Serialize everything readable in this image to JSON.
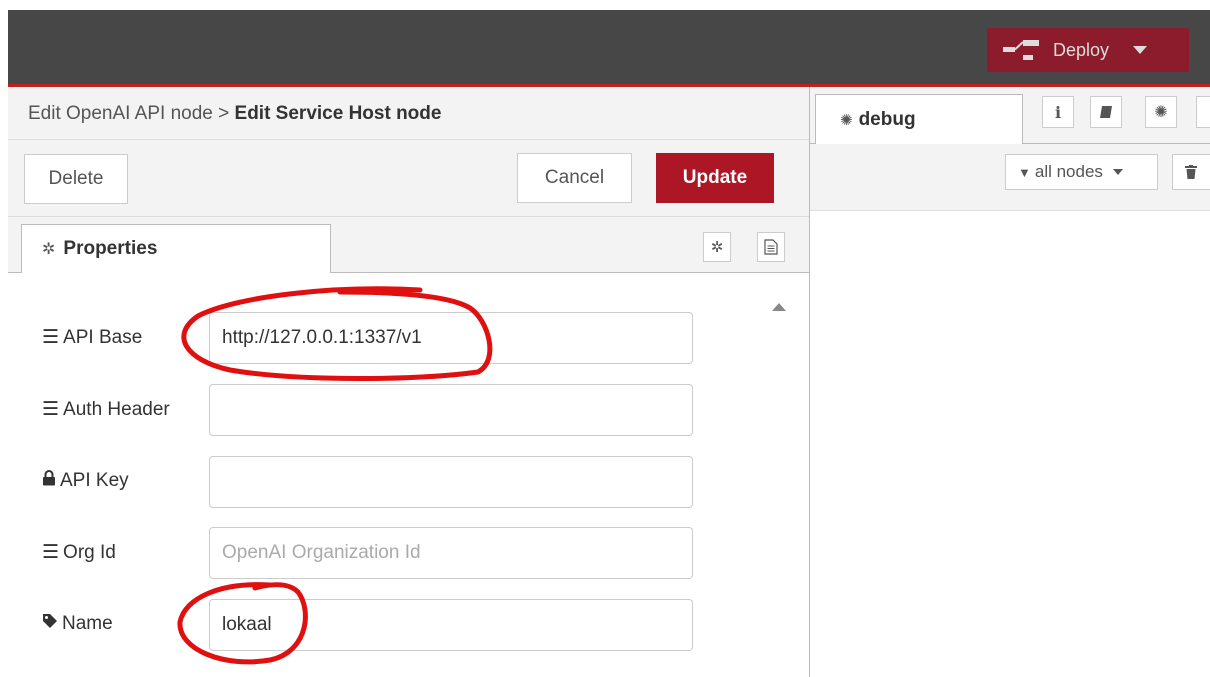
{
  "header": {
    "deploy_label": "Deploy"
  },
  "editor": {
    "breadcrumb_parent": "Edit OpenAI API node",
    "breadcrumb_sep": " > ",
    "breadcrumb_current": "Edit Service Host node",
    "buttons": {
      "delete": "Delete",
      "cancel": "Cancel",
      "update": "Update"
    },
    "tab_properties": "Properties",
    "fields": {
      "api_base": {
        "label": "API Base",
        "value": "http://127.0.0.1:1337/v1",
        "placeholder": ""
      },
      "auth_header": {
        "label": "Auth Header",
        "value": "",
        "placeholder": ""
      },
      "api_key": {
        "label": "API Key",
        "value": "",
        "placeholder": ""
      },
      "org_id": {
        "label": "Org Id",
        "value": "",
        "placeholder": "OpenAI Organization Id"
      },
      "name": {
        "label": "Name",
        "value": "lokaal",
        "placeholder": ""
      }
    }
  },
  "sidebar": {
    "tab_debug": "debug",
    "filter_label": "all nodes"
  },
  "colors": {
    "header_bg": "#474747",
    "deploy_bg": "#8c1c2b",
    "update_bg": "#ad1625",
    "annotation": "#e01010"
  }
}
